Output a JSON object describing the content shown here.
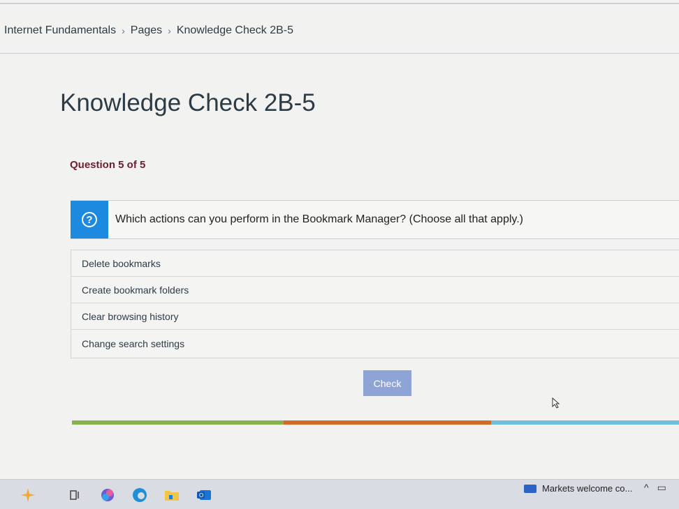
{
  "breadcrumb": {
    "course": "Internet Fundamentals",
    "section": "Pages",
    "current": "Knowledge Check 2B-5",
    "separator": "›"
  },
  "page_title": "Knowledge Check 2B-5",
  "quiz": {
    "question_count": "Question 5 of 5",
    "prompt_icon": "help-icon",
    "prompt_text": "Which actions can you perform in the Bookmark Manager? (Choose all that apply.)",
    "options": [
      "Delete bookmarks",
      "Create bookmark folders",
      "Clear browsing history",
      "Change search settings"
    ],
    "check_label": "Check"
  },
  "colors": {
    "help_blue": "#1d8ae0",
    "check_button": "#8ea3d6",
    "progress_green": "#87b24c",
    "progress_orange": "#d06b2a",
    "progress_blue": "#6fbede",
    "question_count": "#6b1f2f"
  },
  "taskbar": {
    "apps": [
      "copilot-icon",
      "task-view-icon",
      "copilot-app-icon",
      "edge-icon",
      "file-explorer-icon",
      "outlook-icon"
    ],
    "news_text": "Markets welcome co...",
    "tray": [
      "chevron-up-icon",
      "network-icon"
    ]
  }
}
